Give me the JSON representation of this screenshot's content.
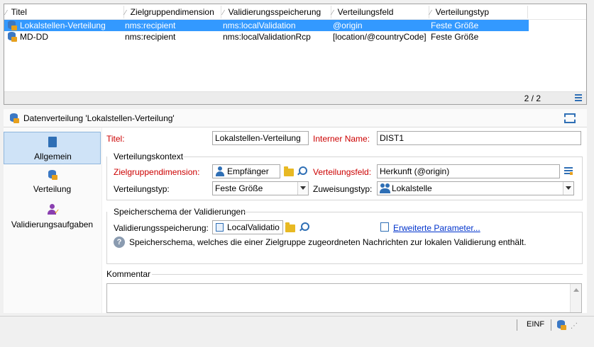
{
  "list": {
    "columns": [
      "Titel",
      "Zielgruppendimension",
      "Validierungsspeicherung",
      "Verteilungsfeld",
      "Verteilungstyp"
    ],
    "rows": [
      {
        "title": "Lokalstellen-Verteilung",
        "target": "nms:recipient",
        "validation": "nms:localValidation",
        "field": "@origin",
        "type": "Feste Größe"
      },
      {
        "title": "MD-DD",
        "target": "nms:recipient",
        "validation": "nms:localValidationRcp",
        "field": "[location/@countryCode]",
        "type": "Feste Größe"
      }
    ],
    "count": "2 / 2"
  },
  "detail": {
    "title": "Datenverteilung 'Lokalstellen-Verteilung'"
  },
  "nav": {
    "items": [
      {
        "label": "Allgemein"
      },
      {
        "label": "Verteilung"
      },
      {
        "label": "Validierungsaufgaben"
      }
    ]
  },
  "form": {
    "titel_label": "Titel:",
    "titel_value": "Lokalstellen-Verteilung",
    "interner_label": "Interner Name:",
    "interner_value": "DIST1",
    "group1_title": "Verteilungskontext",
    "zielgruppe_label": "Zielgruppendimension:",
    "zielgruppe_value": "Empfänger",
    "vfeld_label": "Verteilungsfeld:",
    "vfeld_value": "Herkunft (@origin)",
    "vtyp_label": "Verteilungstyp:",
    "vtyp_value": "Feste Größe",
    "ztyp_label": "Zuweisungstyp:",
    "ztyp_value": "Lokalstelle",
    "group2_title": "Speicherschema der Validierungen",
    "vspeicher_label": "Validierungsspeicherung:",
    "vspeicher_value": "LocalValidatio",
    "advanced_link": "Erweiterte Parameter...",
    "info_text": "Speicherschema, welches die einer Zielgruppe zugeordneten Nachrichten zur lokalen Validierung enthält.",
    "comment_label": "Kommentar"
  },
  "status": {
    "ins": "EINF"
  }
}
